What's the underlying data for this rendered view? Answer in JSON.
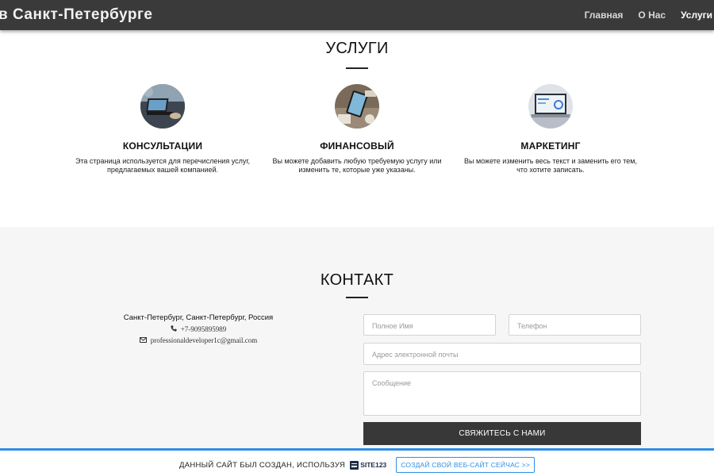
{
  "header": {
    "brand": "в Санкт-Петербурге",
    "nav": [
      {
        "label": "Главная",
        "active": false
      },
      {
        "label": "О Нас",
        "active": false
      },
      {
        "label": "Услуги",
        "active": true
      }
    ]
  },
  "services": {
    "title": "УСЛУГИ",
    "items": [
      {
        "title": "КОНСУЛЬТАЦИИ",
        "text": "Эта страница используется для перечисления услуг, предлагаемых вашей компанией.",
        "image": "laptop-desk-photo"
      },
      {
        "title": "ФИНАНСОВЫЙ",
        "text": "Вы можете добавить любую требуемую услугу или изменить те, которые уже указаны.",
        "image": "tablet-finance-photo"
      },
      {
        "title": "МАРКЕТИНГ",
        "text": "Вы можете изменить весь текст и заменить его тем, что хотите записать.",
        "image": "laptop-charts-photo"
      }
    ]
  },
  "contact": {
    "title": "КОНТАКТ",
    "address": "Санкт-Петербург, Санкт-Петербург, Россия",
    "phone": "+7-9095895989",
    "email": "professionaldeveloper1c@gmail.com",
    "form": {
      "name_placeholder": "Полное Имя",
      "phone_placeholder": "Телефон",
      "email_placeholder": "Адрес электронной почты",
      "message_placeholder": "Сообщение",
      "submit_label": "СВЯЖИТЕСЬ С НАМИ"
    }
  },
  "footer": {
    "text": "ДАННЫЙ САЙТ БЫЛ СОЗДАН, ИСПОЛЬЗУЯ",
    "logo": "SITE123",
    "cta": "СОЗДАЙ СВОЙ ВЕБ-САЙТ СЕЙЧАС >>",
    "accent": "#2f8fe6"
  }
}
